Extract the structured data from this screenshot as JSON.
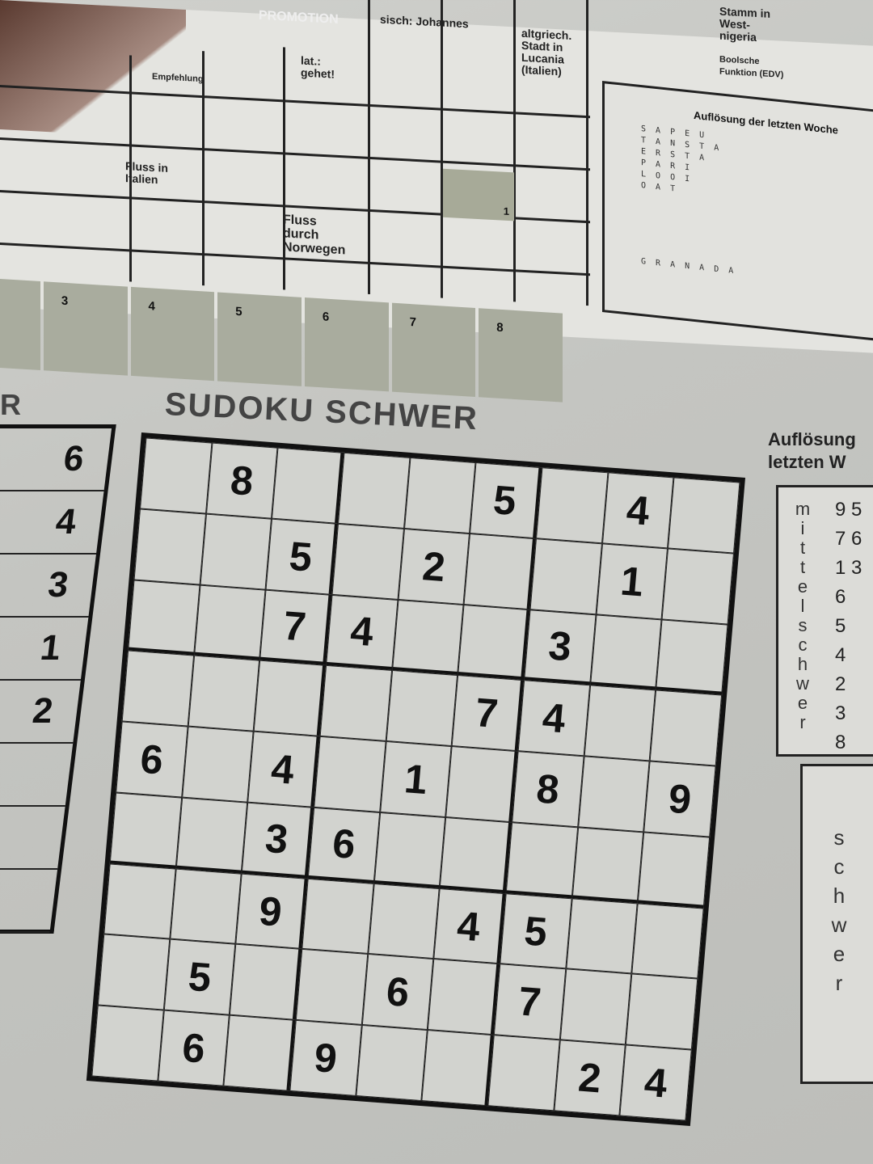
{
  "crossword": {
    "clues": [
      "sisch: Johannes",
      "altgriech. Stadt in Lucania (Italien)",
      "Stamm in West-nigeria",
      "Boolsche Funktion (EDV)",
      "lat.: gehet!",
      "Empfehlung",
      "Fluss in Italien",
      "Fluss durch Norwegen"
    ],
    "shaded_number": "1",
    "promo_text": "PROMOTION",
    "solution_numbers": [
      "3",
      "4",
      "5",
      "6",
      "7",
      "8"
    ]
  },
  "previous_solution": {
    "title": "Auflösung der letzten Woche",
    "letters": [
      "S A P E U",
      "T A N S T A",
      "E R S T A",
      "P A R I",
      "L O O I",
      "O A T",
      "G R A N A D A"
    ]
  },
  "sudoku": {
    "title": "SUDOKU SCHWER",
    "grid": [
      [
        "",
        "8",
        "",
        "",
        "",
        "5",
        "",
        "4",
        ""
      ],
      [
        "",
        "",
        "5",
        "",
        "2",
        "",
        "",
        "1",
        ""
      ],
      [
        "",
        "",
        "7",
        "4",
        "",
        "",
        "3",
        "",
        ""
      ],
      [
        "",
        "",
        "",
        "",
        "",
        "7",
        "4",
        "",
        ""
      ],
      [
        "6",
        "",
        "4",
        "",
        "1",
        "",
        "8",
        "",
        "9"
      ],
      [
        "",
        "",
        "3",
        "6",
        "",
        "",
        "",
        "",
        ""
      ],
      [
        "",
        "",
        "9",
        "",
        "",
        "4",
        "5",
        "",
        ""
      ],
      [
        "",
        "5",
        "",
        "",
        "6",
        "",
        "7",
        "",
        ""
      ],
      [
        "",
        "6",
        "",
        "9",
        "",
        "",
        "",
        "2",
        "4"
      ]
    ]
  },
  "left_puzzle": {
    "title_fragment": "R",
    "digits": [
      "6",
      "4",
      "3",
      "1",
      "2"
    ]
  },
  "right_solution": {
    "title_line1": "Auflösung",
    "title_line2": "letzten W",
    "label_mittelschwer": "mittelschwer",
    "label_schwer": "schwer",
    "digits": [
      "9 5",
      "7 6",
      "1 3",
      "6",
      "5",
      "4",
      "2",
      "3",
      "8"
    ]
  }
}
